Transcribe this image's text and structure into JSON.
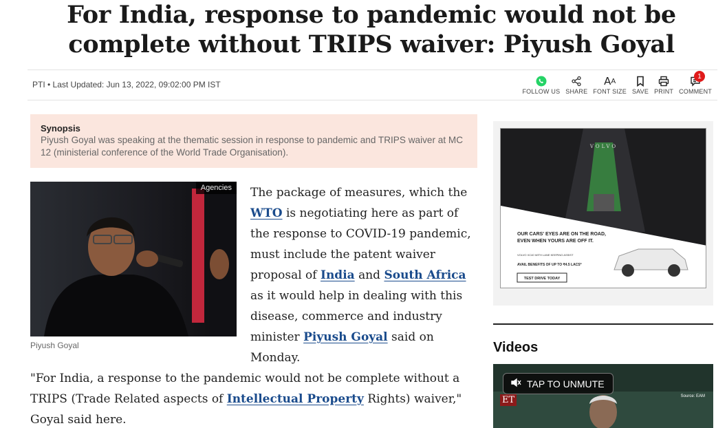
{
  "headline": "For India, response to pandemic would not be complete without TRIPS waiver: Piyush Goyal",
  "byline": "PTI • Last Updated: Jun 13, 2022, 09:02:00 PM IST",
  "tools": [
    {
      "label": "FOLLOW US",
      "icon": "whatsapp-icon"
    },
    {
      "label": "SHARE",
      "icon": "share-icon"
    },
    {
      "label": "FONT SIZE",
      "icon": "font-size-icon"
    },
    {
      "label": "SAVE",
      "icon": "bookmark-icon"
    },
    {
      "label": "PRINT",
      "icon": "print-icon"
    },
    {
      "label": "COMMENT",
      "icon": "comment-icon"
    }
  ],
  "comment_count": "1",
  "synopsis": {
    "title": "Synopsis",
    "body": "Piyush Goyal was speaking at the thematic session in response to pandemic and TRIPS waiver at MC 12 (ministerial conference of the World Trade Organisation)."
  },
  "photo": {
    "tag": "Agencies",
    "caption": "Piyush Goyal"
  },
  "para1": {
    "t1": "The package of measures, which the ",
    "link_wto": "WTO",
    "t2": " is negotiating here as part of the response to COVID-19 pandemic, must include the patent waiver proposal of ",
    "link_india": "India",
    "t3": " and ",
    "link_sa": "South Africa",
    "t4": " as it would help in dealing with this disease, commerce and industry minister ",
    "link_goyal": "Piyush Goyal",
    "t5": " said on Monday."
  },
  "para2": {
    "t1": "\"For India, a response to the pandemic would not be complete without a TRIPS (Trade Related aspects of ",
    "link_ip": "Intellectual Property",
    "t2": " Rights) waiver,\" Goyal said here."
  },
  "ad": {
    "brand": "VOLVO",
    "line1": "OUR CARS' EYES ARE ON THE ROAD,",
    "line2": "EVEN WHEN YOURS ARE OFF IT.",
    "small": "VOLVO XC40 WITH LANE KEEPING ASSIST",
    "benefits": "AVAIL BENEFITS OF UP TO ₹4.5 LACS*",
    "cta": "TEST DRIVE TODAY"
  },
  "videos": {
    "title": "Videos",
    "unmute": "TAP TO UNMUTE",
    "logo": "ET",
    "source": "Source: EAM"
  },
  "colors": {
    "link": "#1a4b8c",
    "synopsis_bg": "#fbe6de",
    "badge": "#e01a1a"
  }
}
